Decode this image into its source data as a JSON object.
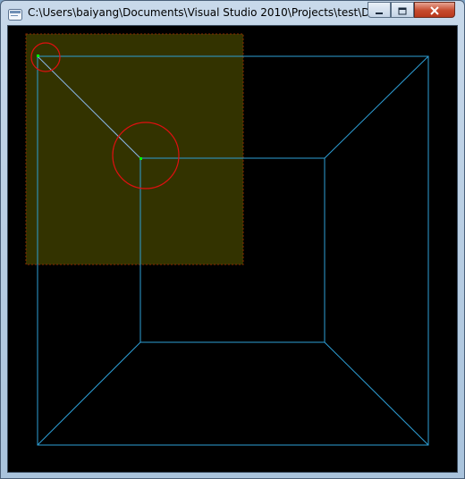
{
  "window": {
    "title": "C:\\Users\\baiyang\\Documents\\Visual Studio 2010\\Projects\\test\\Debu...",
    "icons": [
      "app-icon",
      "minimize-icon",
      "maximize-icon",
      "close-icon"
    ]
  },
  "scene": {
    "background_color": "#000000",
    "wireframe_color": "#2e9fd6",
    "line_color": "#8ab8e8",
    "overlay_color": "#333300",
    "overlay_border_color": "#8a2a00",
    "circle_color": "#e01010",
    "point_color": "#00ff00"
  }
}
